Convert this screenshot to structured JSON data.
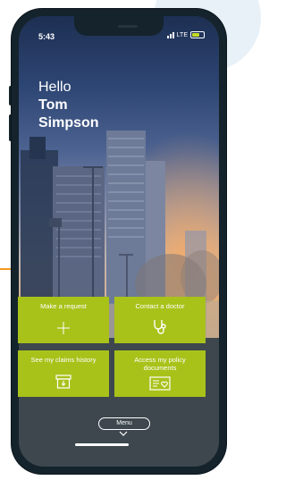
{
  "status_bar": {
    "time": "5:43",
    "network": "LTE"
  },
  "greeting": {
    "line1": "Hello",
    "line2": "Tom",
    "line3": "Simpson"
  },
  "tiles": [
    {
      "label": "Make a request",
      "icon": "plus-icon"
    },
    {
      "label": "Contact a doctor",
      "icon": "stethoscope-icon"
    },
    {
      "label": "See my claims history",
      "icon": "archive-box-icon"
    },
    {
      "label": "Access my policy documents",
      "icon": "document-heart-icon"
    }
  ],
  "menu": {
    "label": "Menu",
    "icon": "chevron-down-icon"
  },
  "colors": {
    "tile_green": "#a8c21a",
    "phone_frame": "#14232c",
    "panel_bg": "#3d474d",
    "accent_orange": "#f39a24"
  }
}
